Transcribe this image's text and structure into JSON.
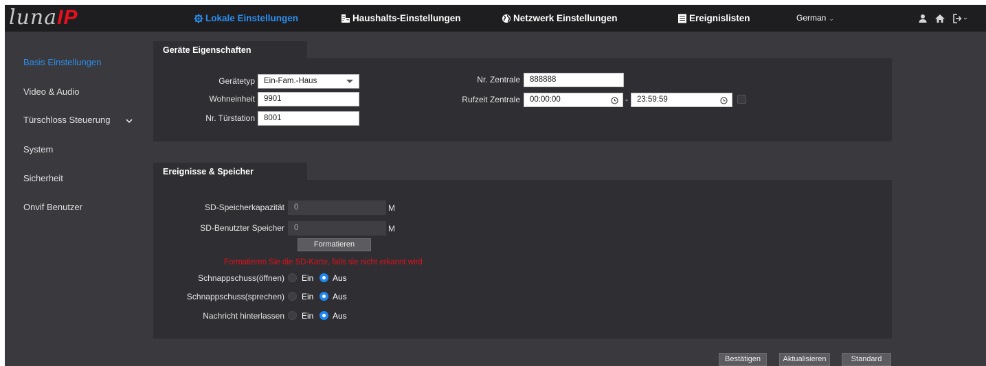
{
  "header": {
    "logo_text": "luna",
    "logo_accent": "IP",
    "nav": [
      {
        "label": "Lokale Einstellungen",
        "icon": "gear-icon",
        "active": true
      },
      {
        "label": "Haushalts-Einstellungen",
        "icon": "building-icon",
        "active": false
      },
      {
        "label": "Netzwerk Einstellungen",
        "icon": "globe-icon",
        "active": false
      },
      {
        "label": "Ereignislisten",
        "icon": "list-icon",
        "active": false
      }
    ],
    "language": "German",
    "language_caret": "⌄"
  },
  "sidebar": {
    "items": [
      {
        "label": "Basis Einstellungen",
        "active": true
      },
      {
        "label": "Video & Audio",
        "active": false
      },
      {
        "label": "Türschloss Steuerung",
        "active": false
      },
      {
        "label": "System",
        "active": false
      },
      {
        "label": "Sicherheit",
        "active": false
      },
      {
        "label": "Onvif Benutzer",
        "active": false
      }
    ]
  },
  "device": {
    "tab_label": "Geräte Eigenschaften",
    "device_type_label": "Gerätetyp",
    "device_type_value": "Ein-Fam.-Haus",
    "unit_label": "Wohneinheit",
    "unit_value": "9901",
    "station_label": "Nr. Türstation",
    "station_value": "8001",
    "central_label": "Nr. Zentrale",
    "central_value": "888888",
    "call_time_label": "Rufzeit Zentrale",
    "call_time_from": "00:00:00",
    "call_time_sep": "-",
    "call_time_to": "23:59:59"
  },
  "storage": {
    "tab_label": "Ereignisse & Speicher",
    "sd_capacity_label": "SD-Speicherkapazität",
    "sd_capacity_value": "0",
    "sd_used_label": "SD-Benutzter Speicher",
    "sd_used_value": "0",
    "unit": "M",
    "format_button": "Formatieren",
    "warning": "Formatieren Sie die SD-Karte, falls sie nicht erkannt wird",
    "options": [
      {
        "label": "Schnappschuss(öffnen)",
        "on_label": "Ein",
        "off_label": "Aus",
        "selected": "Aus"
      },
      {
        "label": "Schnappschuss(sprechen)",
        "on_label": "Ein",
        "off_label": "Aus",
        "selected": "Aus"
      },
      {
        "label": "Nachricht hinterlassen",
        "on_label": "Ein",
        "off_label": "Aus",
        "selected": "Aus"
      }
    ]
  },
  "footer": {
    "confirm": "Bestätigen",
    "refresh": "Aktualisieren",
    "default": "Standard"
  },
  "colors": {
    "accent": "#2b8ef0",
    "brand_red": "#e8101c",
    "warning": "#e0101a",
    "background": "#3a3a3e",
    "panel": "#2f2f33",
    "topbar": "#1e1e21"
  }
}
